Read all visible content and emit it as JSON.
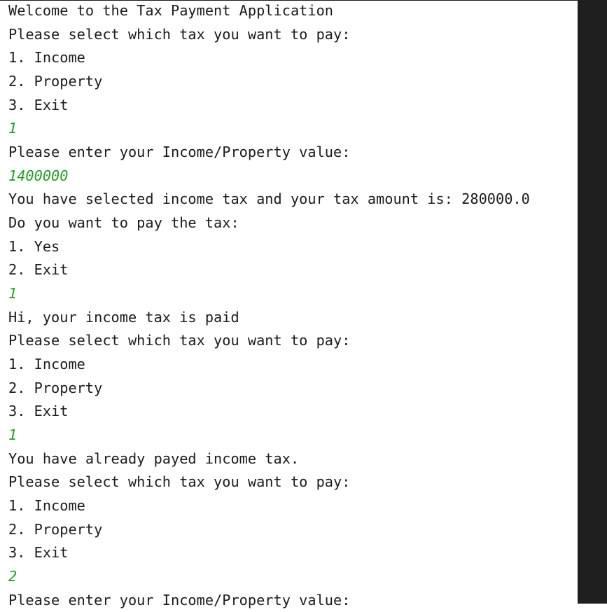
{
  "console": {
    "lines": [
      {
        "text": "Welcome to the Tax Payment Application",
        "type": "output"
      },
      {
        "text": "Please select which tax you want to pay:",
        "type": "output"
      },
      {
        "text": "1. Income",
        "type": "output"
      },
      {
        "text": "2. Property",
        "type": "output"
      },
      {
        "text": "3. Exit",
        "type": "output"
      },
      {
        "text": "1",
        "type": "input"
      },
      {
        "text": "Please enter your Income/Property value:",
        "type": "output"
      },
      {
        "text": "1400000",
        "type": "input"
      },
      {
        "text": "You have selected income tax and your tax amount is: 280000.0",
        "type": "output"
      },
      {
        "text": "Do you want to pay the tax:",
        "type": "output"
      },
      {
        "text": "1. Yes",
        "type": "output"
      },
      {
        "text": "2. Exit",
        "type": "output"
      },
      {
        "text": "1",
        "type": "input"
      },
      {
        "text": "Hi, your income tax is paid",
        "type": "output"
      },
      {
        "text": "Please select which tax you want to pay:",
        "type": "output"
      },
      {
        "text": "1. Income",
        "type": "output"
      },
      {
        "text": "2. Property",
        "type": "output"
      },
      {
        "text": "3. Exit",
        "type": "output"
      },
      {
        "text": "1",
        "type": "input"
      },
      {
        "text": "You have already payed income tax.",
        "type": "output"
      },
      {
        "text": "Please select which tax you want to pay:",
        "type": "output"
      },
      {
        "text": "1. Income",
        "type": "output"
      },
      {
        "text": "2. Property",
        "type": "output"
      },
      {
        "text": "3. Exit",
        "type": "output"
      },
      {
        "text": "2",
        "type": "input"
      },
      {
        "text": "Please enter your Income/Property value:",
        "type": "output"
      }
    ]
  },
  "colors": {
    "input": "#2a9a2a",
    "output": "#1c1c1c",
    "sidebar": "#1f1f1f"
  }
}
